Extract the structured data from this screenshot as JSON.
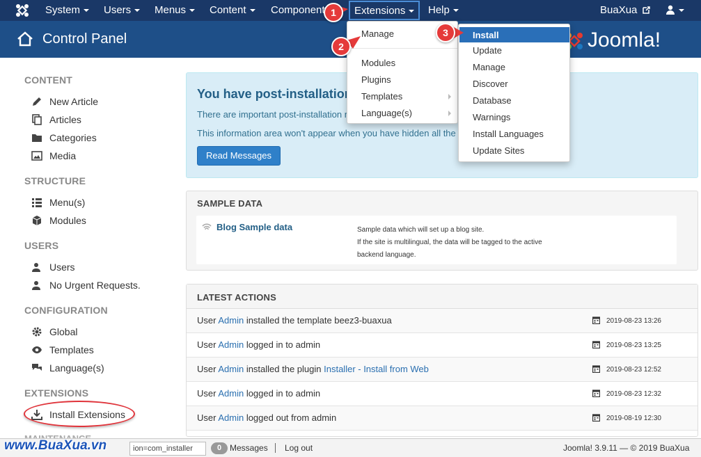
{
  "navbar": {
    "items": [
      "System",
      "Users",
      "Menus",
      "Content",
      "Components",
      "Extensions",
      "Help"
    ],
    "site_link": "BuaXua",
    "logo_icon": "joomla-icon",
    "bg_color": "#1a3867"
  },
  "subhead": {
    "title": "Control Panel",
    "brand": "Joomla!"
  },
  "sidebar": {
    "sections": [
      {
        "heading": "CONTENT",
        "items": [
          "New Article",
          "Articles",
          "Categories",
          "Media"
        ]
      },
      {
        "heading": "STRUCTURE",
        "items": [
          "Menu(s)",
          "Modules"
        ]
      },
      {
        "heading": "USERS",
        "items": [
          "Users",
          "No Urgent Requests."
        ]
      },
      {
        "heading": "CONFIGURATION",
        "items": [
          "Global",
          "Templates",
          "Language(s)"
        ]
      },
      {
        "heading": "EXTENSIONS",
        "items": [
          "Install Extensions"
        ]
      }
    ],
    "maintenance": "MAINTENANCE"
  },
  "alert": {
    "heading": "You have post-installation",
    "line1": "There are important post-installation m",
    "line2": "This information area won't appear when you have hidden all the",
    "button": "Read Messages"
  },
  "sample_data": {
    "heading": "SAMPLE DATA",
    "item_title": "Blog Sample data",
    "desc_line1": "Sample data which will set up a blog site.",
    "desc_line2": "If the site is multilingual, the data will be tagged to the active",
    "desc_line3": "backend language."
  },
  "latest_actions": {
    "heading": "LATEST ACTIONS",
    "rows": [
      {
        "pre": "User ",
        "user": "Admin",
        "post": " installed the template beez3-buaxua",
        "link": "",
        "date": "2019-08-23 13:26"
      },
      {
        "pre": "User ",
        "user": "Admin",
        "post": " logged in to admin",
        "link": "",
        "date": "2019-08-23 13:25"
      },
      {
        "pre": "User ",
        "user": "Admin",
        "post": " installed the plugin ",
        "link": "Installer - Install from Web",
        "date": "2019-08-23 12:52"
      },
      {
        "pre": "User ",
        "user": "Admin",
        "post": " logged in to admin",
        "link": "",
        "date": "2019-08-23 12:32"
      },
      {
        "pre": "User ",
        "user": "Admin",
        "post": " logged out from admin",
        "link": "",
        "date": "2019-08-19 12:30"
      }
    ]
  },
  "extensions_menu": {
    "items": [
      "Manage",
      "Modules",
      "Plugins",
      "Templates",
      "Language(s)"
    ]
  },
  "manage_submenu": {
    "items": [
      "Install",
      "Update",
      "Manage",
      "Discover",
      "Database",
      "Warnings",
      "Install Languages",
      "Update Sites"
    ],
    "active_color": "#2a6fb8"
  },
  "annotations": {
    "markers": [
      "1",
      "2",
      "3"
    ],
    "color": "#e53a3a"
  },
  "footer": {
    "status_url": "ion=com_installer",
    "messages_count": "0",
    "messages_label": "Messages",
    "logout": "Log out",
    "version": "Joomla! 3.9.11  —  © 2019 BuaXua"
  },
  "watermark": "www.BuaXua.vn"
}
